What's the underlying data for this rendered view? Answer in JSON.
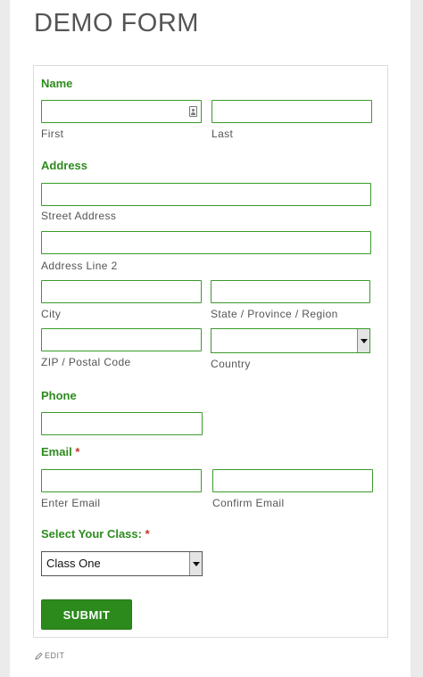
{
  "page": {
    "title": "DEMO FORM"
  },
  "form": {
    "name": {
      "label": "Name",
      "first_label": "First",
      "last_label": "Last"
    },
    "address": {
      "label": "Address",
      "street_label": "Street Address",
      "line2_label": "Address Line 2",
      "city_label": "City",
      "state_label": "State / Province / Region",
      "zip_label": "ZIP / Postal Code",
      "country_label": "Country",
      "country_value": ""
    },
    "phone": {
      "label": "Phone"
    },
    "email": {
      "label": "Email",
      "required_mark": "*",
      "enter_label": "Enter Email",
      "confirm_label": "Confirm Email"
    },
    "class_select": {
      "label": "Select Your Class:",
      "required_mark": "*",
      "value": "Class One"
    },
    "submit_label": "SUBMIT"
  },
  "footer": {
    "edit_label": "EDIT"
  },
  "colors": {
    "accent": "#2e8b1e",
    "button": "#2b8a1b",
    "required": "#c0392b"
  }
}
